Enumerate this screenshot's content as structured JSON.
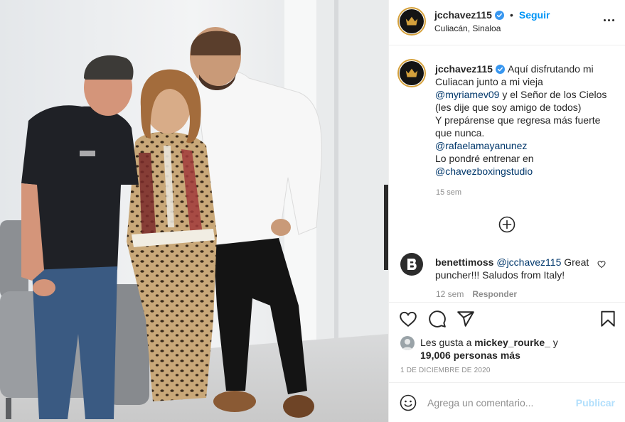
{
  "post": {
    "username": "jcchavez115",
    "follow_label": "Seguir",
    "separator": "•",
    "location": "Culiacán, Sinaloa",
    "caption_lines": [
      "Aquí disfrutando mi",
      "Culiacan junto a mi vieja",
      "@myriamev09",
      " y el Señor de los Cielos",
      "(les dije que soy amigo de todos)",
      "Y prepárense que regresa más fuerte",
      "que nunca.",
      "@rafaelamayanunez",
      "Lo pondré entrenar en",
      "@chavezboxingstudio"
    ],
    "caption_time": "15 sem",
    "comments": [
      {
        "username": "benettimoss",
        "mention": "@jcchavez115",
        "text_1": " Great",
        "text_2": "puncher!!! Saludos from Italy!",
        "time": "12 sem",
        "reply_label": "Responder"
      }
    ],
    "likes": {
      "prefix": "Les gusta a ",
      "user": "mickey_rourke_",
      "middle": " y",
      "count": "19,006 personas más"
    },
    "date": "1 DE DICIEMBRE DE 2020",
    "comment_placeholder": "Agrega un comentario...",
    "publish_label": "Publicar"
  },
  "icons": {
    "verified": "verified-badge-icon",
    "more": "more-options-icon",
    "load_more": "plus-circle-icon",
    "like": "heart-icon",
    "comment": "comment-icon",
    "share": "paper-plane-icon",
    "save": "bookmark-icon",
    "emoji": "emoji-icon"
  },
  "colors": {
    "accent": "#0095f6",
    "mention": "#00376b",
    "secondary": "#8e8e8e",
    "publish_disabled": "#b2dffc",
    "avatar_ring": "#d5a13c"
  }
}
